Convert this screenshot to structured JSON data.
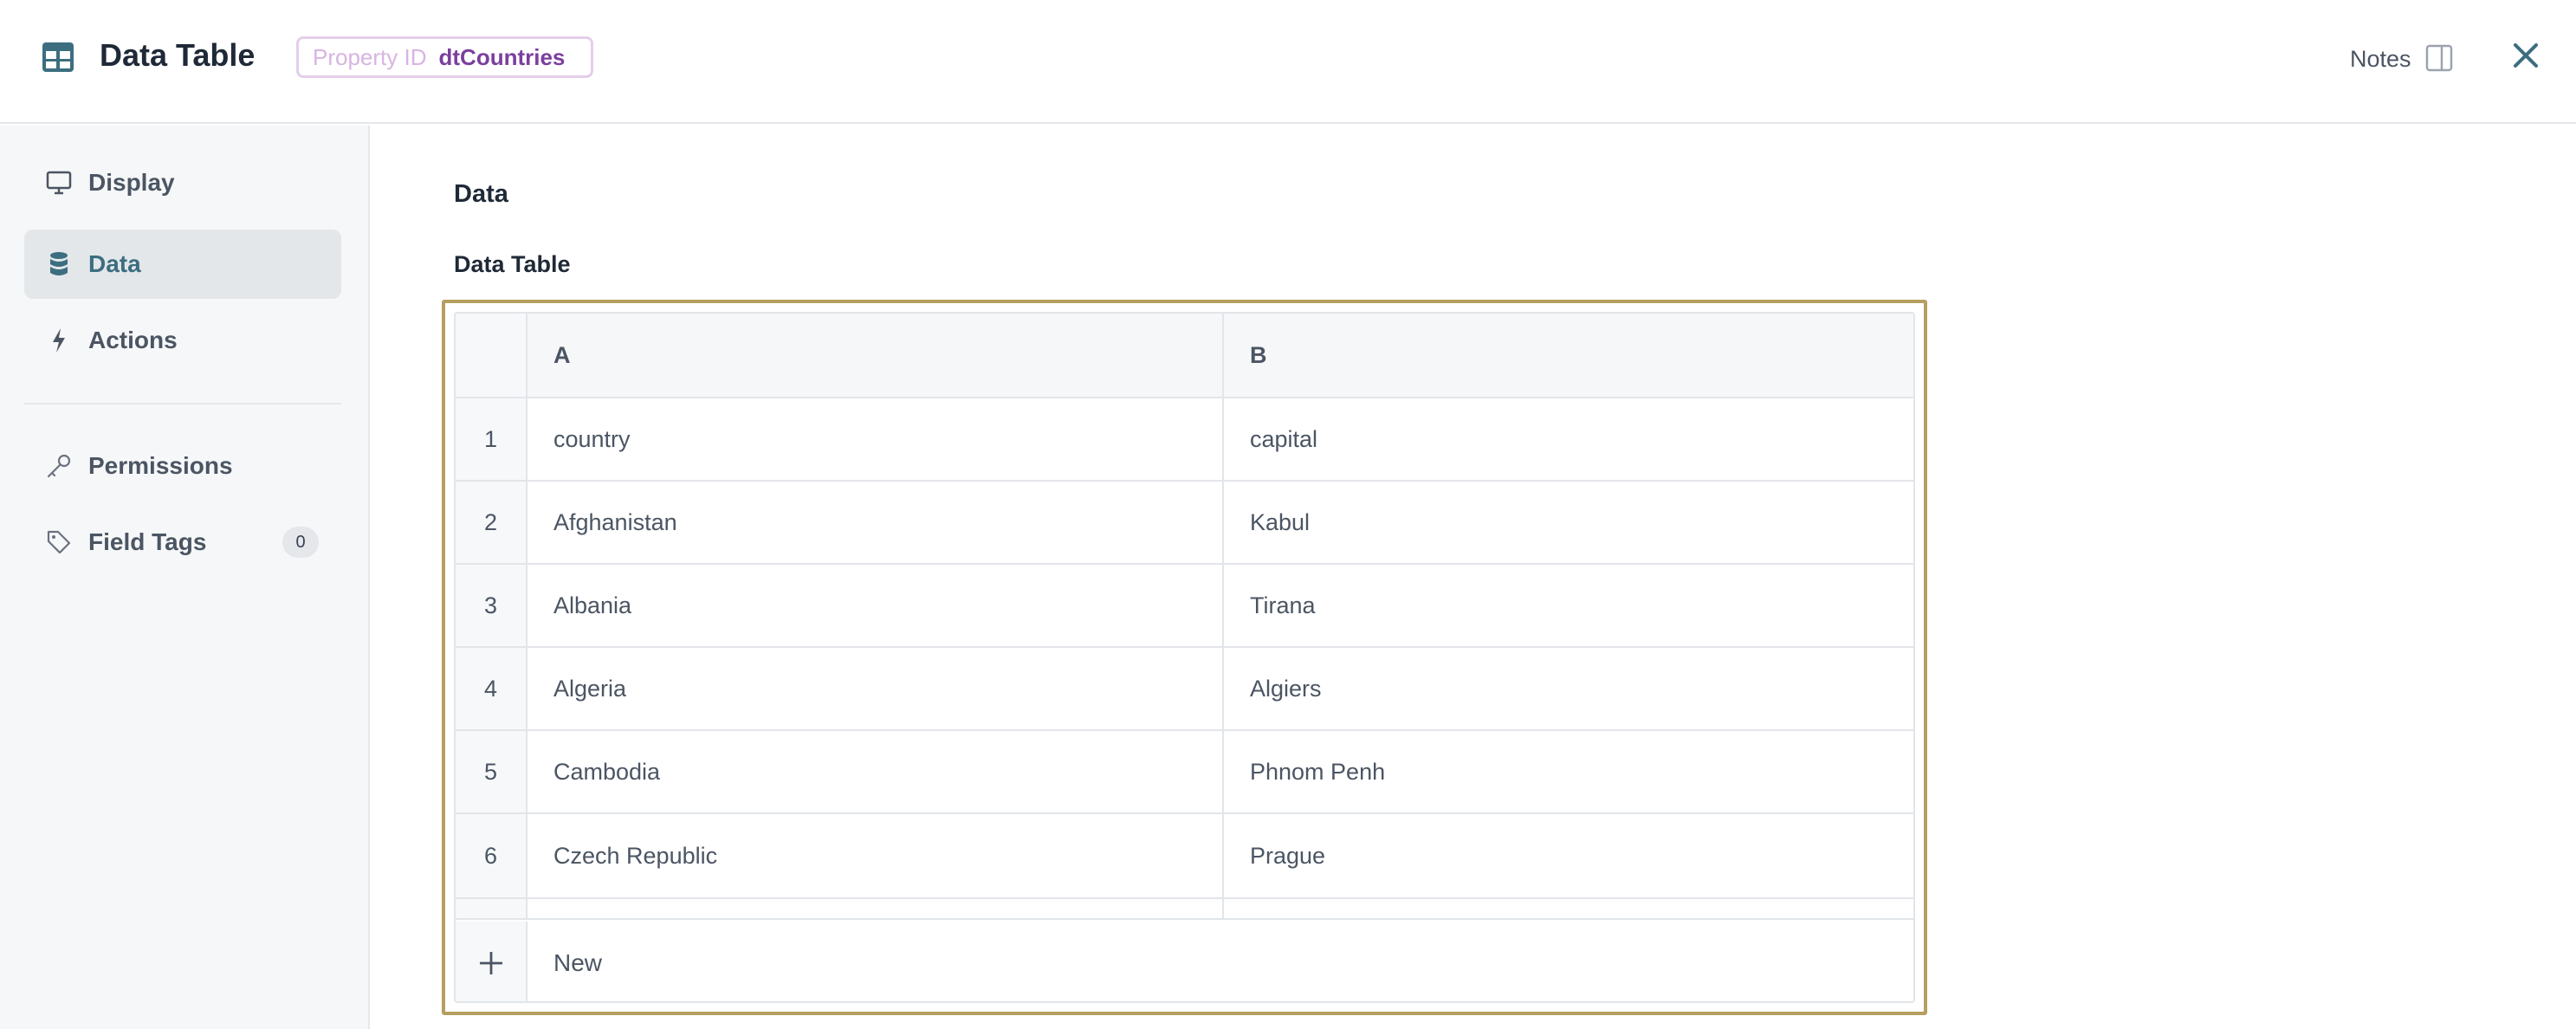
{
  "header": {
    "title": "Data Table",
    "property_label": "Property ID",
    "property_value": "dtCountries",
    "notes_label": "Notes",
    "accent_color": "#3c6e80"
  },
  "sidebar": {
    "items": [
      {
        "label": "Display",
        "icon": "monitor-icon",
        "active": false
      },
      {
        "label": "Data",
        "icon": "database-icon",
        "active": true
      },
      {
        "label": "Actions",
        "icon": "lightning-icon",
        "active": false
      },
      {
        "label": "Permissions",
        "icon": "key-icon",
        "active": false
      },
      {
        "label": "Field Tags",
        "icon": "tag-icon",
        "active": false,
        "count": "0"
      }
    ]
  },
  "main": {
    "section_title": "Data",
    "field_label": "Data Table",
    "table": {
      "columns": [
        "A",
        "B"
      ],
      "rows": [
        {
          "num": "1",
          "a": "country",
          "b": "capital"
        },
        {
          "num": "2",
          "a": "Afghanistan",
          "b": "Kabul"
        },
        {
          "num": "3",
          "a": "Albania",
          "b": "Tirana"
        },
        {
          "num": "4",
          "a": "Algeria",
          "b": "Algiers"
        },
        {
          "num": "5",
          "a": "Cambodia",
          "b": "Phnom Penh"
        },
        {
          "num": "6",
          "a": "Czech Republic",
          "b": "Prague"
        }
      ],
      "new_label": "New"
    }
  }
}
